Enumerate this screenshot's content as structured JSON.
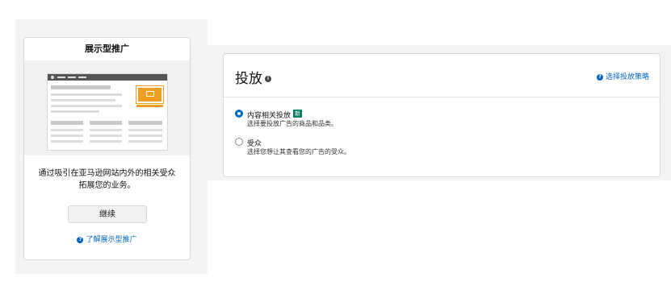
{
  "left_card": {
    "title": "展示型推广",
    "description_line1": "通过吸引在亚马逊网站内外的相关受众",
    "description_line2": "拓展您的业务。",
    "continue_label": "继续",
    "learn_more_label": "了解展示型推广"
  },
  "targeting": {
    "title": "投放",
    "strategy_link": "选择投放策略",
    "options": [
      {
        "label": "内容相关投放",
        "badge": "新",
        "sub": "选择要投放广告的商品和品类。",
        "selected": true
      },
      {
        "label": "受众",
        "sub": "选择您想让其查看您的广告的受众。",
        "selected": false
      }
    ]
  },
  "colors": {
    "link": "#0066c0",
    "accent_illustration": "#f0a020",
    "badge": "#067d62"
  },
  "icons": {
    "help": "question-circle-icon",
    "info": "info-circle-icon"
  }
}
